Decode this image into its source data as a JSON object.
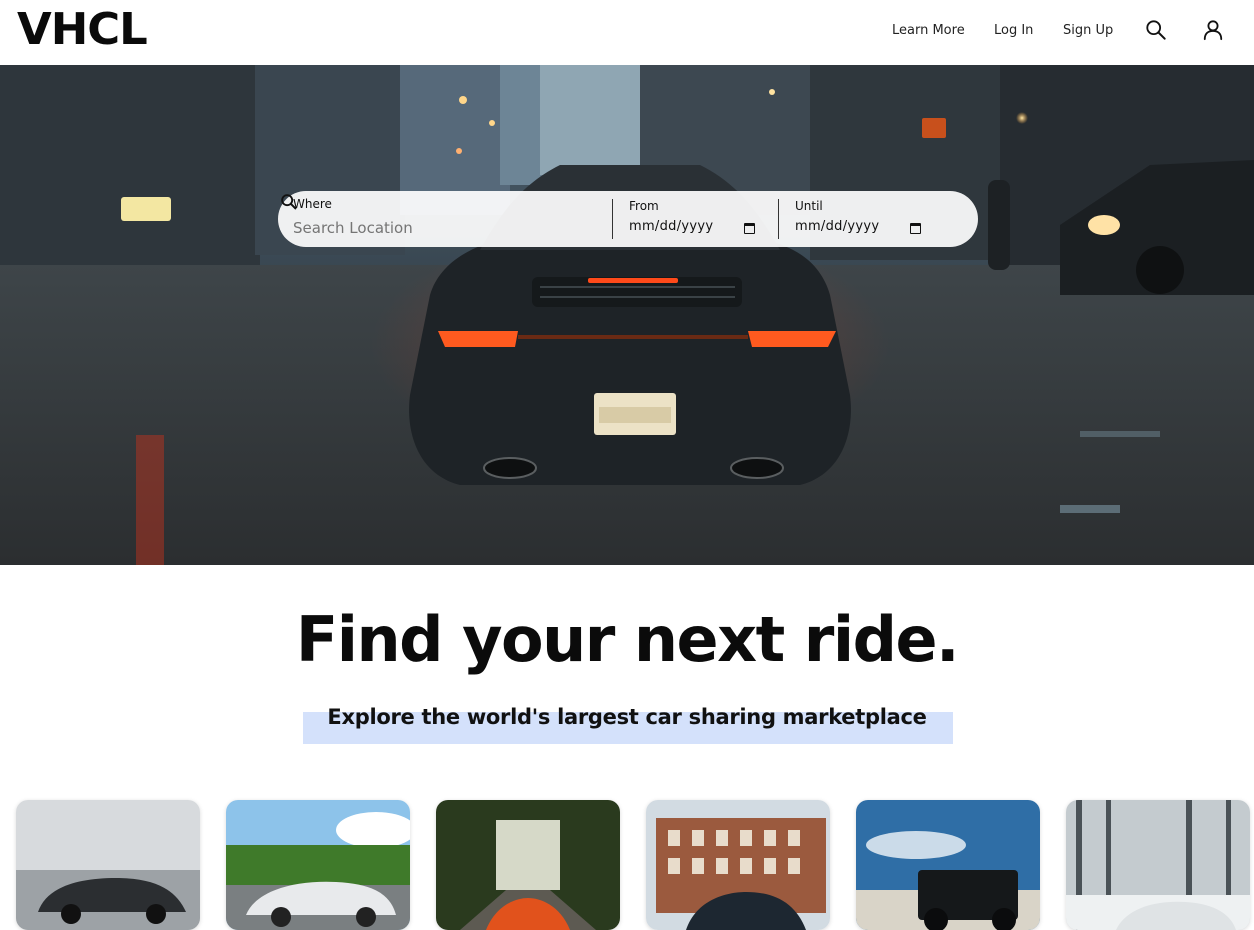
{
  "header": {
    "logo": "VHCL",
    "nav": {
      "learn_more": "Learn More",
      "log_in": "Log In",
      "sign_up": "Sign Up"
    },
    "icons": [
      "search-icon",
      "user-icon"
    ]
  },
  "hero": {
    "image": "rear view of a dark sports car with glowing tail lights on a wet city street",
    "search": {
      "where_label": "Where",
      "where_placeholder": "Search Location",
      "from_label": "From",
      "from_value": "mm/dd/yyyy",
      "until_label": "Until",
      "until_value": "mm/dd/yyyy"
    }
  },
  "main": {
    "headline": "Find your next ride.",
    "subheadline": "Explore the world's largest car sharing marketplace",
    "highlight_color": "#d4e1fb"
  },
  "cards": [
    {
      "name": "car-card-1"
    },
    {
      "name": "car-card-2"
    },
    {
      "name": "car-card-3"
    },
    {
      "name": "car-card-4"
    },
    {
      "name": "car-card-5"
    },
    {
      "name": "car-card-6"
    }
  ]
}
